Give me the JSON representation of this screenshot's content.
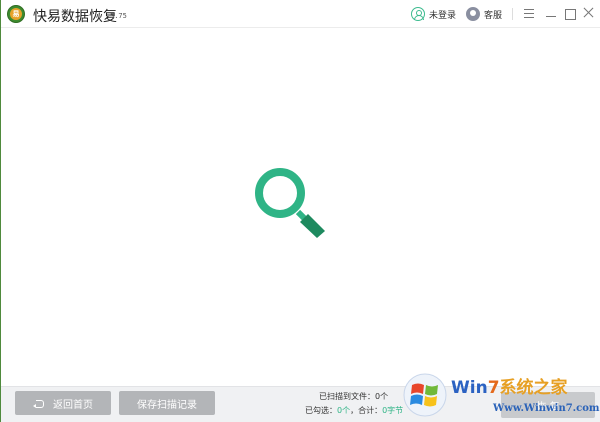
{
  "app": {
    "logo_text": "易",
    "title": "快易数据恢复",
    "version": "5.75"
  },
  "header": {
    "login_label": "未登录",
    "service_label": "客服"
  },
  "bottom": {
    "back_home_label": "返回首页",
    "save_scan_label": "保存扫描记录",
    "scanned_files_prefix": "已扫描到文件：",
    "scanned_files_value": "0个",
    "selected_prefix": "已勾选：",
    "selected_value": "0个",
    "total_prefix": "，合计：",
    "total_value": "0字节",
    "recover_label": "恢 复"
  },
  "watermark": {
    "brand_win": "Win",
    "brand_7": "7",
    "brand_cn": "系统之家",
    "url": "Www.Winwin7.com"
  },
  "colors": {
    "accent_green": "#2fb486",
    "button_gray": "#b3b5b8",
    "window_border": "#4f8a3d"
  },
  "icons": {
    "search": "search-icon",
    "user": "user-icon",
    "service": "headset-icon",
    "menu": "menu-icon",
    "minimize": "minimize-icon",
    "maximize": "maximize-icon",
    "close": "close-icon",
    "back": "back-arrow-icon"
  }
}
